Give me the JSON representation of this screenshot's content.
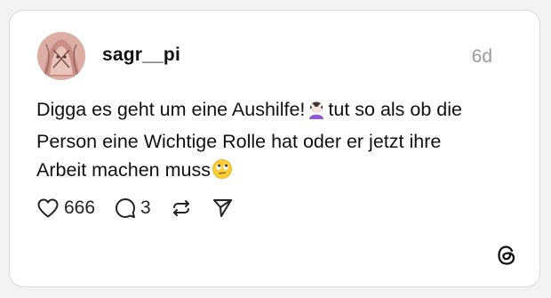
{
  "post": {
    "username": "sagr__pi",
    "timestamp": "6d",
    "text_lines": [
      "Digga es geht um eine Aushilfe!",
      "tut so als ob die",
      "Person eine Wichtige Rolle hat oder er jetzt ihre",
      "Arbeit machen muss"
    ],
    "emojis": [
      "woman-facepalming",
      "face-with-rolling-eyes"
    ]
  },
  "actions": {
    "likes": "666",
    "replies": "3"
  },
  "icons": {
    "like": "heart-icon",
    "reply": "speech-bubble-icon",
    "repost": "repost-icon",
    "share": "send-icon",
    "brand": "threads-logo"
  },
  "colors": {
    "background": "#f3f3f3",
    "card": "#ffffff",
    "border": "#d9d9d9",
    "text": "#111111",
    "muted": "#9a9a9a"
  }
}
